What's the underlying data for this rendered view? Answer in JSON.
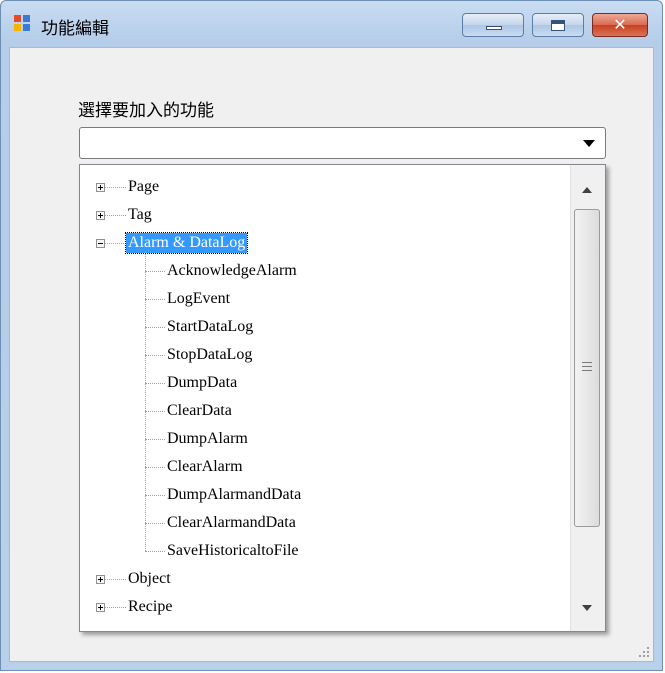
{
  "window": {
    "title": "功能編輯",
    "close_glyph": "✕"
  },
  "form": {
    "label": "選擇要加入的功能",
    "combo_value": ""
  },
  "tree": {
    "nodes": [
      {
        "label": "Page",
        "expanded": false
      },
      {
        "label": "Tag",
        "expanded": false
      },
      {
        "label": "Alarm & DataLog",
        "expanded": true,
        "selected": true,
        "children": [
          "AcknowledgeAlarm",
          "LogEvent",
          "StartDataLog",
          "StopDataLog",
          "DumpData",
          "ClearData",
          "DumpAlarm",
          "ClearAlarm",
          "DumpAlarmandData",
          "ClearAlarmandData",
          "SaveHistoricaltoFile"
        ]
      },
      {
        "label": "Object",
        "expanded": false
      },
      {
        "label": "Recipe",
        "expanded": false
      }
    ]
  },
  "colors": {
    "selection": "#3399ff",
    "title_gradient_top": "#c9dcf2",
    "close_button": "#c7401f"
  },
  "icons": {
    "app": "form-app-icon",
    "minimize": "minimize-icon",
    "maximize": "maximize-icon",
    "close": "close-icon",
    "combo": "chevron-down-icon",
    "scroll_up": "scroll-up-arrow-icon",
    "scroll_down": "scroll-down-arrow-icon"
  }
}
